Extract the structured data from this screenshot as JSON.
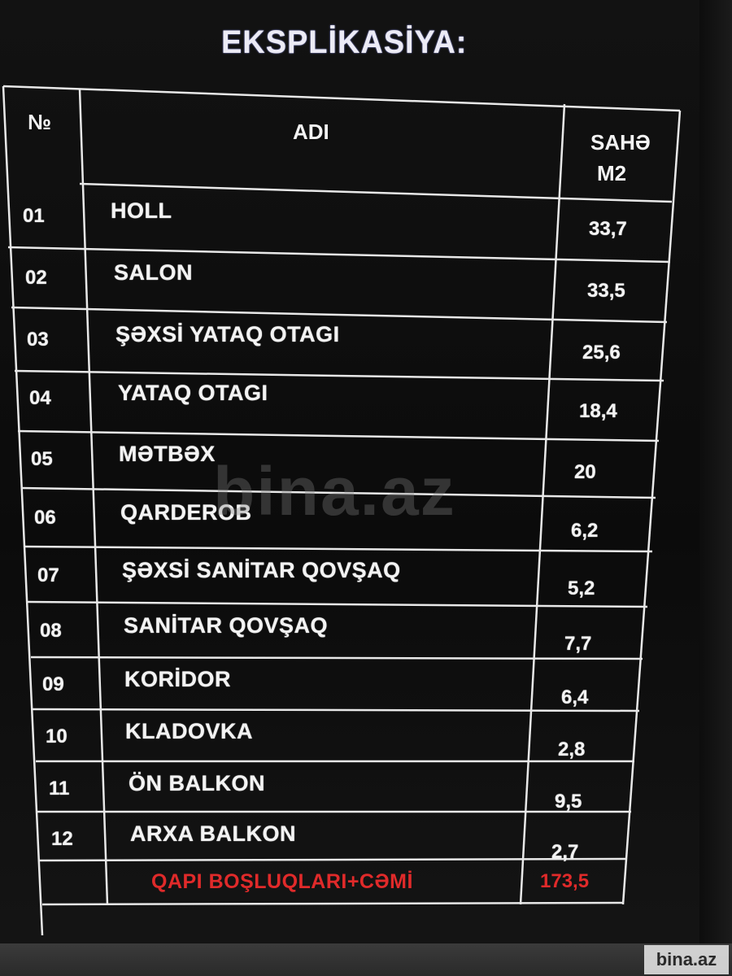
{
  "title": "EKSPLİKASİYA:",
  "headers": {
    "number": "№",
    "name": "ADI",
    "area_line1": "SAHƏ",
    "area_line2": "M2"
  },
  "rows": [
    {
      "no": "01",
      "name": "HOLL",
      "area": "33,7"
    },
    {
      "no": "02",
      "name": "SALON",
      "area": "33,5"
    },
    {
      "no": "03",
      "name": "ŞƏXSİ YATAQ OTAGI",
      "area": "25,6"
    },
    {
      "no": "04",
      "name": "YATAQ OTAGI",
      "area": "18,4"
    },
    {
      "no": "05",
      "name": "MƏTBƏX",
      "area": "20"
    },
    {
      "no": "06",
      "name": "QARDEROB",
      "area": "6,2"
    },
    {
      "no": "07",
      "name": "ŞƏXSİ SANİTAR QOVŞAQ",
      "area": "5,2"
    },
    {
      "no": "08",
      "name": "SANİTAR QOVŞAQ",
      "area": "7,7"
    },
    {
      "no": "09",
      "name": "KORİDOR",
      "area": "6,4"
    },
    {
      "no": "10",
      "name": "KLADOVKA",
      "area": "2,8"
    },
    {
      "no": "11",
      "name": "ÖN BALKON",
      "area": "9,5"
    },
    {
      "no": "12",
      "name": "ARXA BALKON",
      "area": "2,7"
    }
  ],
  "total": {
    "label": "QAPI BOŞLUQLARI+CƏMİ",
    "area": "173,5"
  },
  "watermark": "bina.az",
  "badge": "bina.az",
  "colors": {
    "background": "#0a0a0a",
    "text": "#f3f3f3",
    "total": "#e02a2a",
    "grid": "#e8e8e8"
  }
}
